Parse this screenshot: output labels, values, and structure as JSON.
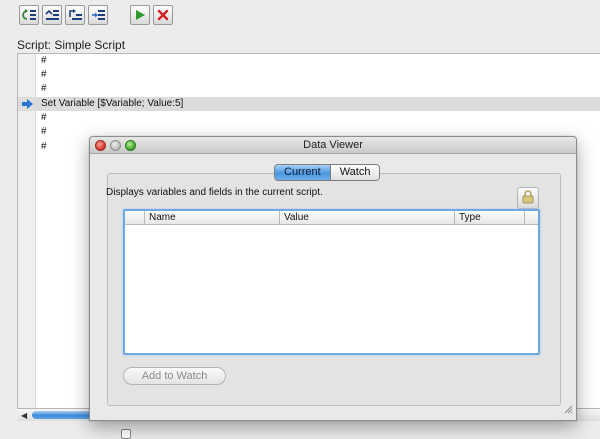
{
  "toolbar": {
    "buttons": [
      {
        "icon": "step-into-icon"
      },
      {
        "icon": "step-over-icon"
      },
      {
        "icon": "step-out-icon"
      },
      {
        "icon": "set-next-step-icon"
      },
      {
        "icon": "run-icon"
      },
      {
        "icon": "halt-icon"
      }
    ]
  },
  "script": {
    "label": "Script: Simple Script",
    "lines": [
      {
        "text": "#",
        "current": false
      },
      {
        "text": "#",
        "current": false
      },
      {
        "text": "#",
        "current": false
      },
      {
        "text": "Set Variable [$Variable; Value:5]",
        "current": true
      },
      {
        "text": "#",
        "current": false
      },
      {
        "text": "#",
        "current": false
      },
      {
        "text": "#",
        "current": false
      }
    ]
  },
  "data_viewer": {
    "title": "Data Viewer",
    "tabs": [
      {
        "label": "Current",
        "active": true
      },
      {
        "label": "Watch",
        "active": false
      }
    ],
    "description": "Displays variables and fields in the current script.",
    "table": {
      "columns": [
        "Name",
        "Value",
        "Type"
      ],
      "rows": []
    },
    "add_to_watch_label": "Add to Watch",
    "lock_icon": "lock-icon"
  },
  "colors": {
    "accent": "#4b97e0",
    "run_green": "#2b9a2b",
    "halt_red": "#d32020",
    "current_line": "#dcdcdc"
  }
}
